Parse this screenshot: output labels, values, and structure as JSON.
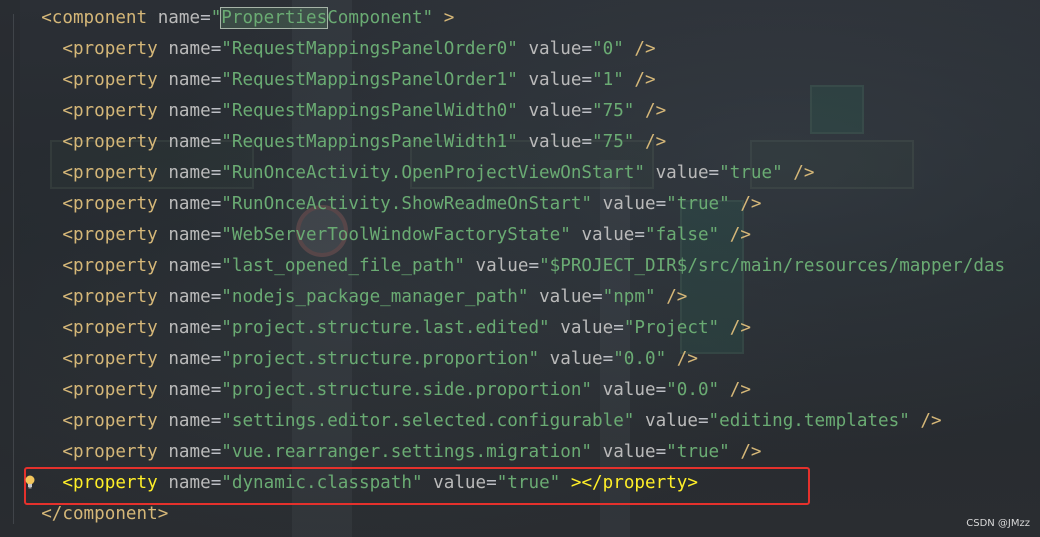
{
  "editor": {
    "lines": [
      {
        "indent": "  ",
        "open": "<",
        "tag": "component",
        "attrs": [
          {
            "name": "name",
            "value": "\"PropertiesComponent\""
          }
        ],
        "close": ">",
        "highlight_word": "Properties"
      },
      {
        "indent": "    ",
        "open": "<",
        "tag": "property",
        "attrs": [
          {
            "name": "name",
            "value": "\"RequestMappingsPanelOrder0\""
          },
          {
            "name": "value",
            "value": "\"0\""
          }
        ],
        "close": "/>"
      },
      {
        "indent": "    ",
        "open": "<",
        "tag": "property",
        "attrs": [
          {
            "name": "name",
            "value": "\"RequestMappingsPanelOrder1\""
          },
          {
            "name": "value",
            "value": "\"1\""
          }
        ],
        "close": "/>"
      },
      {
        "indent": "    ",
        "open": "<",
        "tag": "property",
        "attrs": [
          {
            "name": "name",
            "value": "\"RequestMappingsPanelWidth0\""
          },
          {
            "name": "value",
            "value": "\"75\""
          }
        ],
        "close": "/>"
      },
      {
        "indent": "    ",
        "open": "<",
        "tag": "property",
        "attrs": [
          {
            "name": "name",
            "value": "\"RequestMappingsPanelWidth1\""
          },
          {
            "name": "value",
            "value": "\"75\""
          }
        ],
        "close": "/>"
      },
      {
        "indent": "    ",
        "open": "<",
        "tag": "property",
        "attrs": [
          {
            "name": "name",
            "value": "\"RunOnceActivity.OpenProjectViewOnStart\""
          },
          {
            "name": "value",
            "value": "\"true\""
          }
        ],
        "close": "/>"
      },
      {
        "indent": "    ",
        "open": "<",
        "tag": "property",
        "attrs": [
          {
            "name": "name",
            "value": "\"RunOnceActivity.ShowReadmeOnStart\""
          },
          {
            "name": "value",
            "value": "\"true\""
          }
        ],
        "close": "/>"
      },
      {
        "indent": "    ",
        "open": "<",
        "tag": "property",
        "attrs": [
          {
            "name": "name",
            "value": "\"WebServerToolWindowFactoryState\""
          },
          {
            "name": "value",
            "value": "\"false\""
          }
        ],
        "close": "/>"
      },
      {
        "indent": "    ",
        "open": "<",
        "tag": "property",
        "attrs": [
          {
            "name": "name",
            "value": "\"last_opened_file_path\""
          },
          {
            "name": "value",
            "value": "\"$PROJECT_DIR$/src/main/resources/mapper/das"
          }
        ],
        "close": ""
      },
      {
        "indent": "    ",
        "open": "<",
        "tag": "property",
        "attrs": [
          {
            "name": "name",
            "value": "\"nodejs_package_manager_path\""
          },
          {
            "name": "value",
            "value": "\"npm\""
          }
        ],
        "close": "/>"
      },
      {
        "indent": "    ",
        "open": "<",
        "tag": "property",
        "attrs": [
          {
            "name": "name",
            "value": "\"project.structure.last.edited\""
          },
          {
            "name": "value",
            "value": "\"Project\""
          }
        ],
        "close": "/>"
      },
      {
        "indent": "    ",
        "open": "<",
        "tag": "property",
        "attrs": [
          {
            "name": "name",
            "value": "\"project.structure.proportion\""
          },
          {
            "name": "value",
            "value": "\"0.0\""
          }
        ],
        "close": "/>"
      },
      {
        "indent": "    ",
        "open": "<",
        "tag": "property",
        "attrs": [
          {
            "name": "name",
            "value": "\"project.structure.side.proportion\""
          },
          {
            "name": "value",
            "value": "\"0.0\""
          }
        ],
        "close": "/>"
      },
      {
        "indent": "    ",
        "open": "<",
        "tag": "property",
        "attrs": [
          {
            "name": "name",
            "value": "\"settings.editor.selected.configurable\""
          },
          {
            "name": "value",
            "value": "\"editing.templates\""
          }
        ],
        "close": "/>"
      },
      {
        "indent": "    ",
        "open": "<",
        "tag": "property",
        "attrs": [
          {
            "name": "name",
            "value": "\"vue.rearranger.settings.migration\""
          },
          {
            "name": "value",
            "value": "\"true\""
          }
        ],
        "close": "/>"
      },
      {
        "indent": "    ",
        "open": "<",
        "tag": "property",
        "attrs": [
          {
            "name": "name",
            "value": "\"dynamic.classpath\""
          },
          {
            "name": "value",
            "value": "\"true\""
          }
        ],
        "close": "></property>",
        "selected": true
      },
      {
        "indent": "  ",
        "open": "</",
        "tag": "component",
        "attrs": [],
        "close": ">"
      }
    ]
  },
  "watermark": "CSDN @JMzz",
  "colors": {
    "tag": "#d5b778",
    "string": "#6aab73",
    "attribute": "#bababa",
    "selection_box": "#e5312c",
    "bulb": "#f2c55c"
  },
  "icons": {
    "bulb": "lightbulb-icon"
  }
}
